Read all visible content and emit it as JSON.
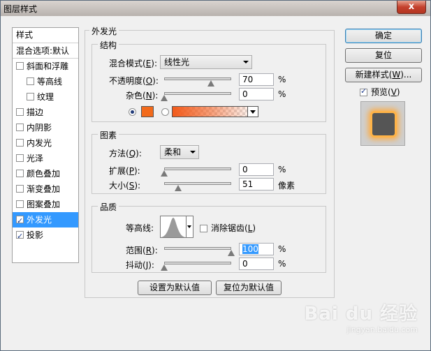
{
  "window": {
    "title": "图层样式",
    "close": "x"
  },
  "styles_panel": {
    "header": "样式",
    "blend_options": "混合选项:默认",
    "items": [
      {
        "label": "斜面和浮雕",
        "checked": false,
        "indent": false
      },
      {
        "label": "等高线",
        "checked": false,
        "indent": true
      },
      {
        "label": "纹理",
        "checked": false,
        "indent": true
      },
      {
        "label": "描边",
        "checked": false,
        "indent": false
      },
      {
        "label": "内阴影",
        "checked": false,
        "indent": false
      },
      {
        "label": "内发光",
        "checked": false,
        "indent": false
      },
      {
        "label": "光泽",
        "checked": false,
        "indent": false
      },
      {
        "label": "颜色叠加",
        "checked": false,
        "indent": false
      },
      {
        "label": "渐变叠加",
        "checked": false,
        "indent": false
      },
      {
        "label": "图案叠加",
        "checked": false,
        "indent": false
      },
      {
        "label": "外发光",
        "checked": true,
        "indent": false,
        "selected": true
      },
      {
        "label": "投影",
        "checked": true,
        "indent": false
      }
    ]
  },
  "outer_glow": {
    "title": "外发光",
    "structure": {
      "title": "结构",
      "blend_mode_label": "混合模式(",
      "blend_mode_key": "E",
      "blend_mode_value": "线性光",
      "opacity_label": "不透明度(",
      "opacity_key": "O",
      "opacity_value": 70,
      "opacity_value_text": "70",
      "noise_label": "杂色(",
      "noise_key": "N",
      "noise_value": 0,
      "noise_value_text": "0",
      "percent": "%",
      "glow_color": "#f26a1b"
    },
    "elements": {
      "title": "图素",
      "method_label": "方法(",
      "method_key": "Q",
      "method_value": "柔和",
      "spread_label": "扩展(",
      "spread_key": "P",
      "spread_value": 0,
      "spread_value_text": "0",
      "size_label": "大小(",
      "size_key": "S",
      "size_value": 51,
      "size_value_text": "51",
      "size_unit": "像素",
      "percent": "%"
    },
    "quality": {
      "title": "品质",
      "contour_label": "等高线:",
      "antialias_label": "消除锯齿(",
      "antialias_key": "L",
      "range_label": "范围(",
      "range_key": "R",
      "range_value": 100,
      "range_value_text": "100",
      "jitter_label": "抖动(",
      "jitter_key": "J",
      "jitter_value": 0,
      "jitter_value_text": "0",
      "percent": "%"
    },
    "set_default": "设置为默认值",
    "reset_default": "复位为默认值"
  },
  "buttons": {
    "ok": "确定",
    "reset": "复位",
    "new_style": "新建样式(",
    "new_style_key": "W",
    "new_style_suffix": ")...",
    "preview_label": "预览(",
    "preview_key": "V",
    "preview_checked": true
  },
  "watermark": {
    "brand": "Bai du 经验",
    "url": "jingyan.baidu.com"
  },
  "colors": {
    "accent": "#3399ff",
    "glow": "#f26a1b"
  }
}
